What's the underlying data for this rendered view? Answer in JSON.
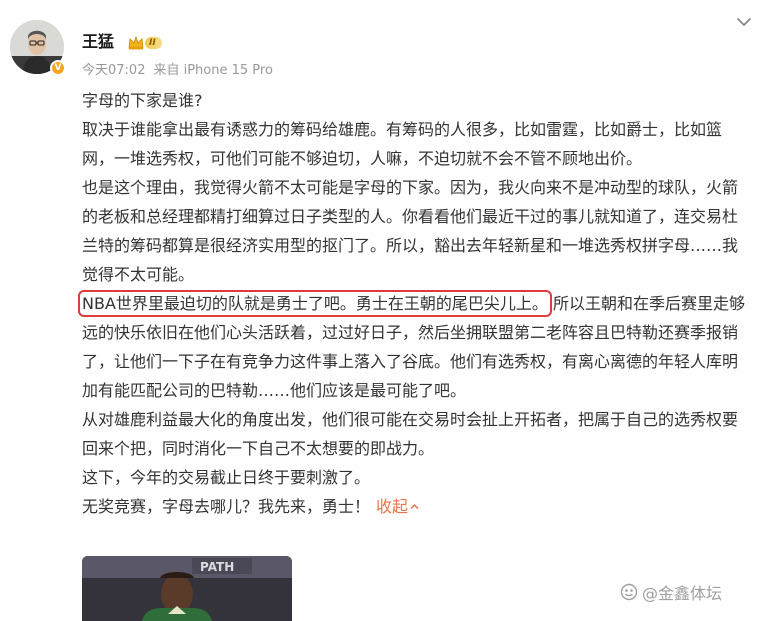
{
  "post": {
    "author": {
      "name": "王猛",
      "level": "II"
    },
    "meta": {
      "time": "今天07:02",
      "source": "来自 iPhone 15 Pro"
    },
    "paragraphs": [
      "字母的下家是谁?",
      "取决于谁能拿出最有诱惑力的筹码给雄鹿。有筹码的人很多，比如雷霆，比如爵士，比如篮网，一堆选秀权，可他们可能不够迫切，人嘛，不迫切就不会不管不顾地出价。",
      "也是这个理由，我觉得火箭不太可能是字母的下家。因为，我火向来不是冲动型的球队，火箭的老板和总经理都精打细算过日子类型的人。你看看他们最近干过的事儿就知道了，连交易杜兰特的筹码都算是很经济实用型的抠门了。所以，豁出去年轻新星和一堆选秀权拼字母……我觉得不太可能。"
    ],
    "highlight_text": "NBA世界里最迫切的队就是勇士了吧。勇士在王朝的尾巴尖儿上。",
    "highlight_rest": "所以王朝和在季后赛里走够远的快乐依旧在他们心头活跃着，过过好日子，然后坐拥联盟第二老阵容且巴特勒还赛季报销了，让他们一下子在有竞争力这件事上落入了谷底。他们有选秀权，有离心离德的年轻人库明加有能匹配公司的巴特勒……他们应该是最可能了吧。",
    "paragraphs_after": [
      "从对雄鹿利益最大化的角度出发，他们很可能在交易时会扯上开拓者，把属于自己的选秀权要回来个把，同时消化一下自己不太想要的即战力。",
      "这下，今年的交易截止日终于要刺激了。"
    ],
    "closing": "无奖竞赛，字母去哪儿？我先来，勇士！",
    "collapse_label": "收起",
    "image_sign_text": "PATH"
  },
  "watermark": "@金鑫体坛",
  "colors": {
    "link": "#eb7350",
    "highlight_border": "#e03a3a",
    "meta": "#999999",
    "verify": "#f5a623"
  }
}
